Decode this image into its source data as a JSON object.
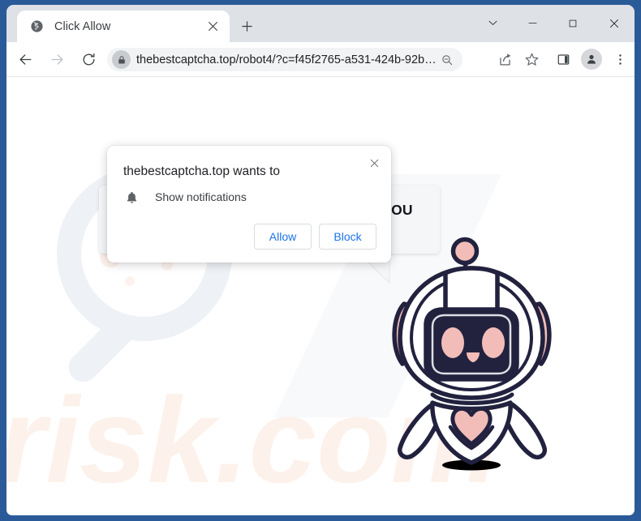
{
  "window": {
    "controls": {
      "tab_search": "tab-search-chevron",
      "minimize": "minimize",
      "maximize": "maximize",
      "close": "close"
    },
    "frame_color": "#2a5b98"
  },
  "tabstrip": {
    "tab": {
      "title": "Click Allow",
      "favicon": "globe-icon",
      "close_label": "×"
    },
    "new_tab_label": "+"
  },
  "toolbar": {
    "back": "back-arrow",
    "forward": "forward-arrow",
    "reload": "reload-arrow",
    "omnibox": {
      "lock": "lock-icon",
      "url_host": "thebestcaptcha.top",
      "url_path": "/robot4/?c=f45f2765-a531-424b-92b…",
      "url_full": "thebestcaptcha.top/robot4/?c=f45f2765-a531-424b-92b…",
      "zoom_out": "zoom-out-icon"
    },
    "share": "share-icon",
    "bookmark": "star-icon",
    "side_panel": "side-panel-icon",
    "profile": "profile-avatar-icon",
    "menu": "three-dot-menu-icon"
  },
  "permission_popup": {
    "title": "thebestcaptcha.top wants to",
    "permission_icon": "bell-icon",
    "permission_label": "Show notifications",
    "allow_label": "Allow",
    "block_label": "Block",
    "close_label": "×",
    "link_color": "#1a73e8"
  },
  "page": {
    "speech_bubble_text": "CLICK «ALLOW» TO CONFIRM THAT YOU ARE NOT A ROBOT!",
    "mascot": "robot-mascot",
    "watermark_text": "risk.com",
    "colors": {
      "robot_outline": "#22223f",
      "robot_accent_pink": "#f2bdb8",
      "bubble_background": "#f4f6f8",
      "watermark_gray": "#eef0f4",
      "watermark_peach": "#fdf2ec"
    }
  }
}
